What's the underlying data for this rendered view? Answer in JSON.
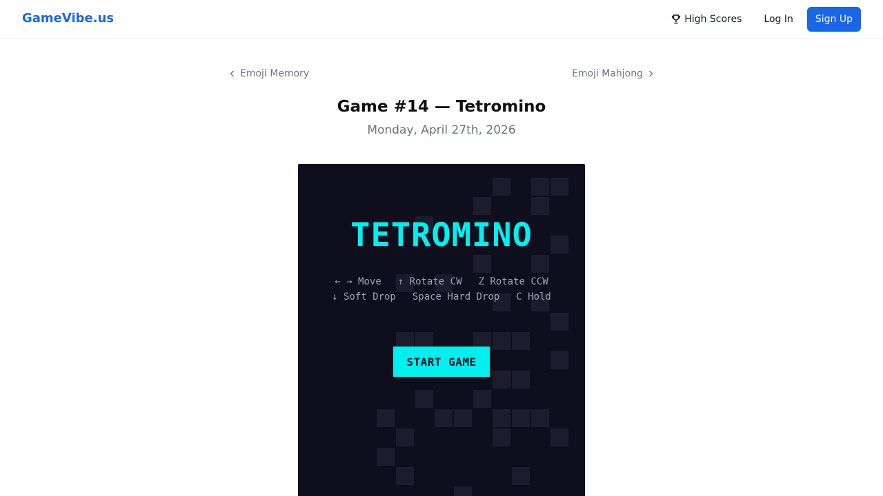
{
  "header": {
    "brand": "GameVibe.us",
    "high_scores_label": "High Scores",
    "high_scores_icon": "trophy-icon",
    "login_label": "Log In",
    "signup_label": "Sign Up"
  },
  "game_nav": {
    "prev_label": "Emoji Memory",
    "next_label": "Emoji Mahjong"
  },
  "page": {
    "title": "Game #14 — Tetromino",
    "date": "Monday, April 27th, 2026"
  },
  "game": {
    "title": "TETROMINO",
    "controls": {
      "move": "← → Move",
      "rotate_cw": "↑ Rotate CW",
      "rotate_ccw": "Z Rotate CCW",
      "soft_drop": "↓ Soft Drop",
      "hard_drop": "Space Hard Drop",
      "hold": "C Hold"
    },
    "start_label": "START GAME"
  },
  "colors": {
    "accent": "#1a66e8",
    "board_bg": "#0e0e1c",
    "game_cyan": "#00f0f0"
  }
}
